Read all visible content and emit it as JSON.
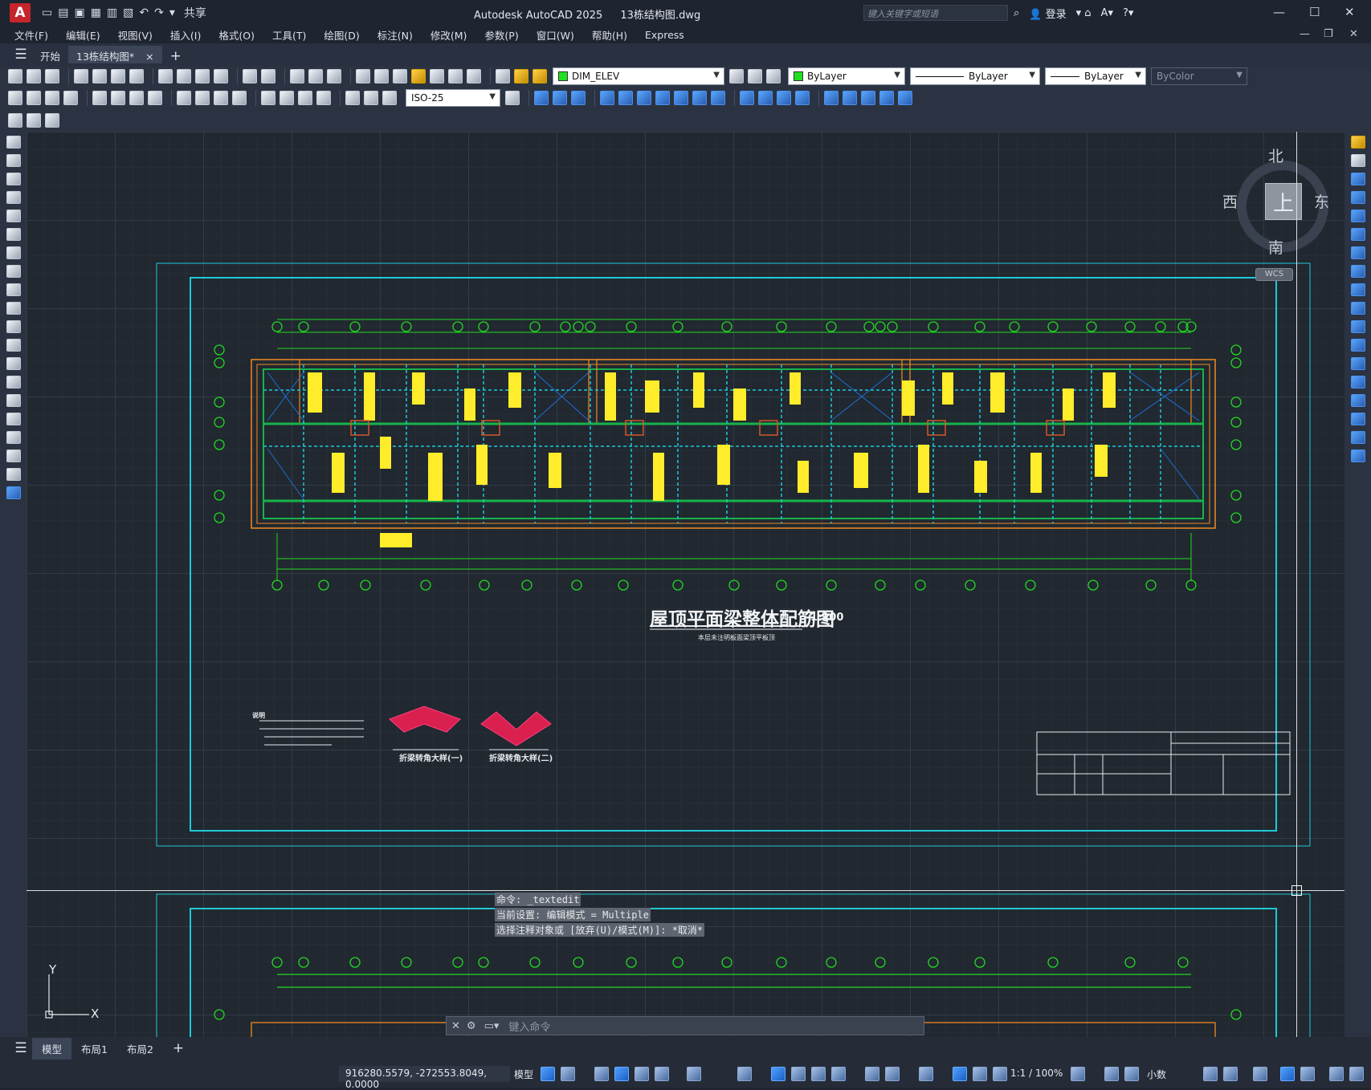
{
  "app": {
    "title": "Autodesk AutoCAD 2025",
    "document": "13栋结构图.dwg",
    "search_placeholder": "键入关键字或短语",
    "login_label": "登录",
    "share_label": "共享"
  },
  "menu": {
    "items": [
      "文件(F)",
      "编辑(E)",
      "视图(V)",
      "插入(I)",
      "格式(O)",
      "工具(T)",
      "绘图(D)",
      "标注(N)",
      "修改(M)",
      "参数(P)",
      "窗口(W)",
      "帮助(H)",
      "Express"
    ]
  },
  "file_tabs": {
    "start": "开始",
    "current": "13栋结构图*",
    "close": "×",
    "add": "+"
  },
  "toolbar": {
    "layer_name": "DIM_ELEV",
    "color": "ByLayer",
    "linetype": "ByLayer",
    "lineweight": "ByLayer",
    "plotstyle": "ByColor",
    "dimstyle": "ISO-25"
  },
  "viewcube": {
    "north": "北",
    "south": "南",
    "east": "东",
    "west": "西",
    "top": "上",
    "wcs": "WCS"
  },
  "drawing": {
    "title": "屋顶平面梁整体配筋图",
    "scale": "1:100",
    "subtitle": "本层未注明板面梁顶平板顶",
    "notes_title": "说明",
    "detail1": "折梁转角大样(一)",
    "detail2": "折梁转角大样(二)"
  },
  "ucs": {
    "x": "X",
    "y": "Y"
  },
  "command": {
    "history": [
      "命令: _textedit",
      "当前设置: 编辑模式 = Multiple",
      "选择注释对象或 [放弃(U)/模式(M)]: *取消*"
    ],
    "placeholder": "键入命令"
  },
  "layout_tabs": [
    "模型",
    "布局1",
    "布局2"
  ],
  "status": {
    "coords": "916280.5579, -272553.8049, 0.0000",
    "space": "模型",
    "scale": "1:1 / 100%",
    "units": "小数"
  },
  "colors": {
    "accent": "#1ec9d8",
    "title_bar": "#1e2430",
    "toolbar": "#2b3241",
    "canvas": "#212830",
    "app_logo": "#c6252b"
  }
}
